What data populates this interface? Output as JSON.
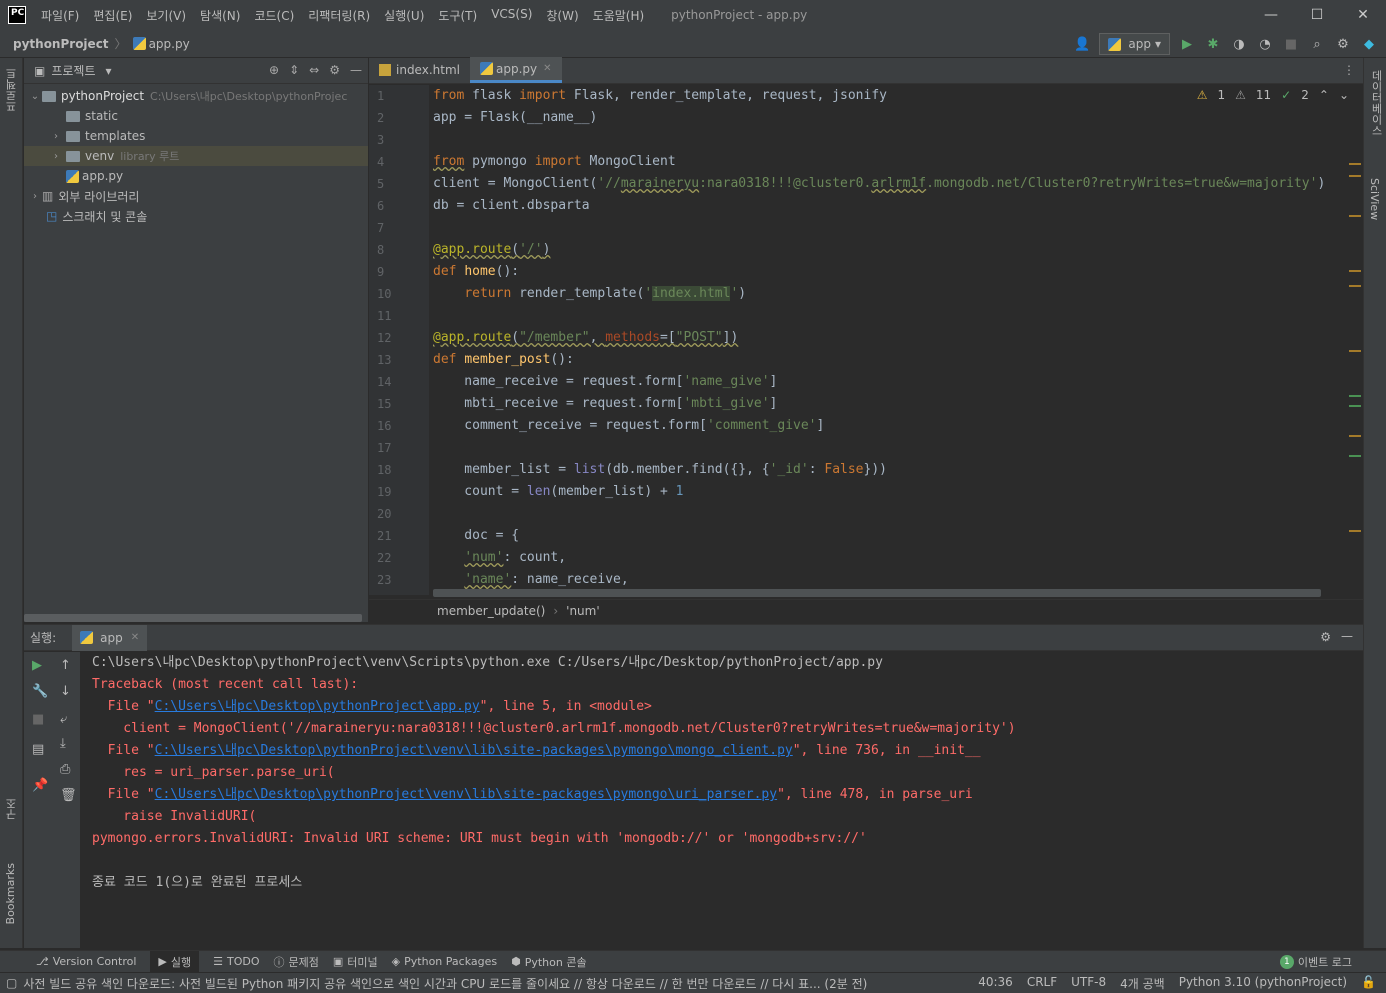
{
  "titlebar": {
    "logo": "PC",
    "menus": [
      "파일(F)",
      "편집(E)",
      "보기(V)",
      "탐색(N)",
      "코드(C)",
      "리팩터링(R)",
      "실행(U)",
      "도구(T)",
      "VCS(S)",
      "창(W)",
      "도움말(H)"
    ],
    "title": "pythonProject - app.py",
    "controls": [
      "—",
      "☐",
      "✕"
    ]
  },
  "navbar": {
    "project": "pythonProject",
    "file": "app.py",
    "run_config": "app"
  },
  "left_strip": {
    "project": "프로젝트",
    "structure": "구조",
    "bookmarks": "Bookmarks"
  },
  "right_strip": {
    "database": "데이터베이스",
    "sciview": "SciView"
  },
  "project_panel": {
    "title": "프로젝트",
    "tree": [
      {
        "label": "pythonProject",
        "path": "C:\\Users\\내pc\\Desktop\\pythonProjec"
      },
      {
        "label": "static"
      },
      {
        "label": "templates"
      },
      {
        "label": "venv",
        "hint": "library 루트"
      },
      {
        "label": "app.py"
      },
      {
        "label": "외부 라이브러리"
      },
      {
        "label": "스크래치 및 콘솔"
      }
    ]
  },
  "editor": {
    "tabs": [
      "index.html",
      "app.py"
    ],
    "inspection": {
      "warn1": "1",
      "warn2": "11",
      "ok": "2"
    },
    "line_numbers": [
      "1",
      "2",
      "3",
      "4",
      "5",
      "6",
      "7",
      "8",
      "9",
      "10",
      "11",
      "12",
      "13",
      "14",
      "15",
      "16",
      "17",
      "18",
      "19",
      "20",
      "21",
      "22",
      "23"
    ],
    "breadcrumb": [
      "member_update()",
      "'num'"
    ]
  },
  "run_panel": {
    "label": "실행:",
    "tab": "app",
    "output": [
      "C:\\Users\\내pc\\Desktop\\pythonProject\\venv\\Scripts\\python.exe C:/Users/내pc/Desktop/pythonProject/app.py",
      "Traceback (most recent call last):",
      "  File \"",
      "C:\\Users\\내pc\\Desktop\\pythonProject\\app.py",
      "\", line 5, in <module>",
      "    client = MongoClient('//maraineryu:nara0318!!!@cluster0.arlrm1f.mongodb.net/Cluster0?retryWrites=true&w=majority')",
      "  File \"",
      "C:\\Users\\내pc\\Desktop\\pythonProject\\venv\\lib\\site-packages\\pymongo\\mongo_client.py",
      "\", line 736, in __init__",
      "    res = uri_parser.parse_uri(",
      "  File \"",
      "C:\\Users\\내pc\\Desktop\\pythonProject\\venv\\lib\\site-packages\\pymongo\\uri_parser.py",
      "\", line 478, in parse_uri",
      "    raise InvalidURI(",
      "pymongo.errors.InvalidURI: Invalid URI scheme: URI must begin with 'mongodb://' or 'mongodb+srv://'",
      "종료 코드 1(으)로 완료된 프로세스"
    ]
  },
  "bottom_tools": [
    "Version Control",
    "실행",
    "TODO",
    "문제점",
    "터미널",
    "Python Packages",
    "Python 콘솔",
    "이벤트 로그"
  ],
  "events_count": "1",
  "status": {
    "message": "사전 빌드 공유 색인 다운로드: 사전 빌드된 Python 패키지 공유 색인으로 색인 시간과 CPU 로드를 줄이세요 // 항상 다운로드 // 한 번만 다운로드 // 다시 표... (2분 전)",
    "position": "40:36",
    "line_sep": "CRLF",
    "encoding": "UTF-8",
    "indent": "4개 공백",
    "interpreter": "Python 3.10 (pythonProject)"
  },
  "colors": {
    "keyword": "#cc7832",
    "string": "#6a8759",
    "error": "#ff6b68",
    "link": "#287bde",
    "accent": "#4a88c7"
  }
}
